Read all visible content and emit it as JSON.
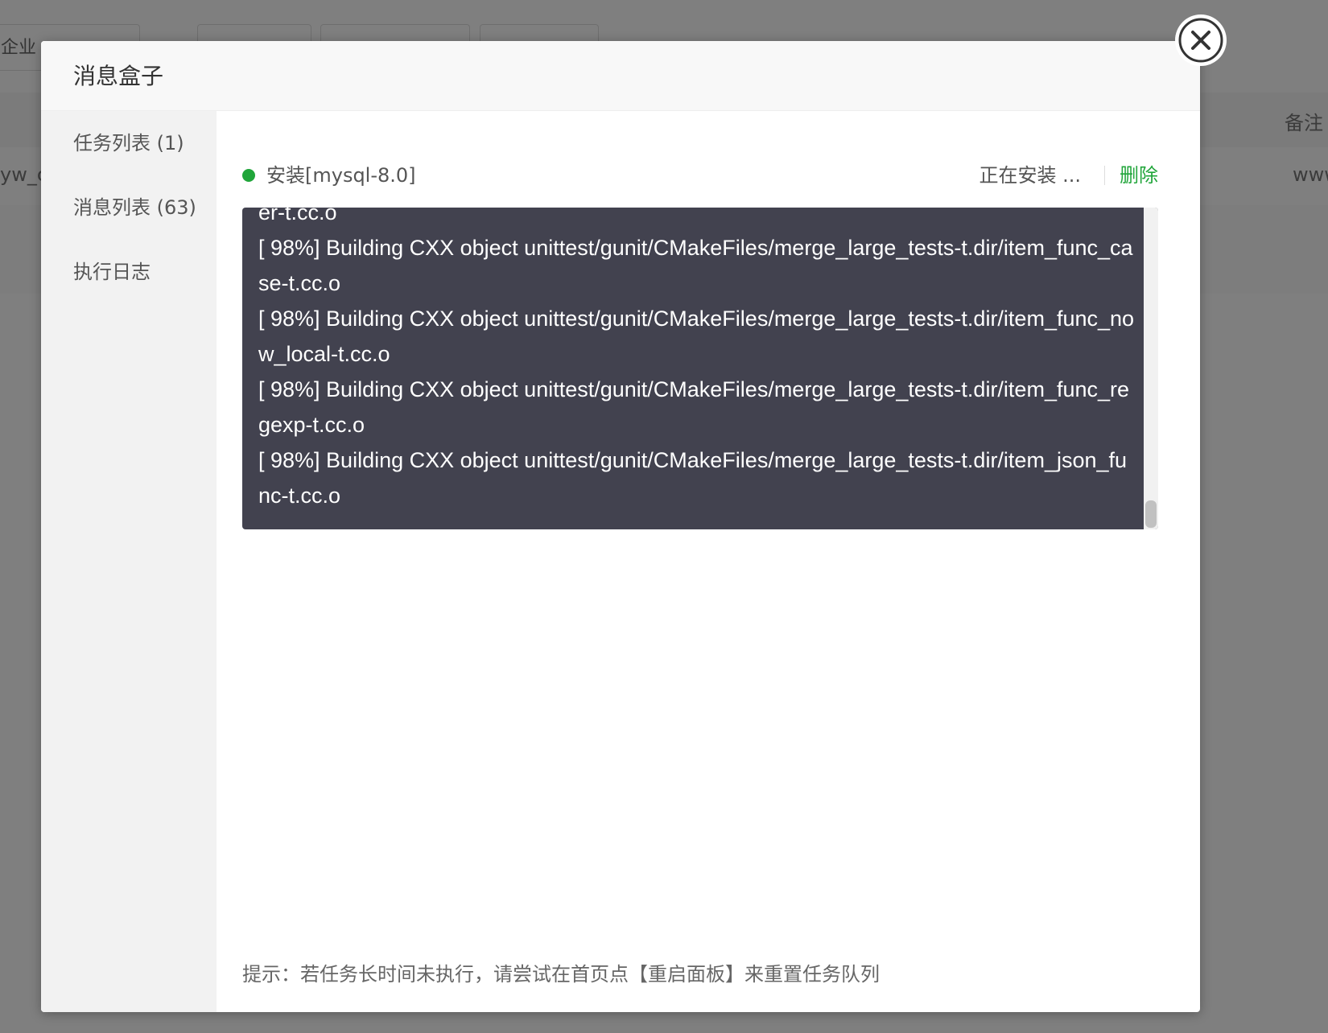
{
  "background": {
    "tabs": [
      "企业",
      "",
      "",
      "",
      ""
    ],
    "column_header": "备注",
    "row_left_text": "yw_c",
    "row_right_text": "www"
  },
  "modal": {
    "title": "消息盒子",
    "sidebar": {
      "items": [
        {
          "label": "任务列表 (1)"
        },
        {
          "label": "消息列表 (63)"
        },
        {
          "label": "执行日志"
        }
      ]
    },
    "task": {
      "name": "安装[mysql-8.0]",
      "status": "正在安装 ...",
      "delete_label": "删除",
      "status_color": "#20a53a"
    },
    "console": {
      "lines": [
        "er-t.cc.o",
        "[ 98%] Building CXX object unittest/gunit/CMakeFiles/merge_large_tests-t.dir/item_func_case-t.cc.o",
        "[ 98%] Building CXX object unittest/gunit/CMakeFiles/merge_large_tests-t.dir/item_func_now_local-t.cc.o",
        "[ 98%] Building CXX object unittest/gunit/CMakeFiles/merge_large_tests-t.dir/item_func_regexp-t.cc.o",
        "[ 98%] Building CXX object unittest/gunit/CMakeFiles/merge_large_tests-t.dir/item_json_func-t.cc.o"
      ]
    },
    "hint": "提示：若任务长时间未执行，请尝试在首页点【重启面板】来重置任务队列",
    "close_icon": "close-circle-icon"
  }
}
